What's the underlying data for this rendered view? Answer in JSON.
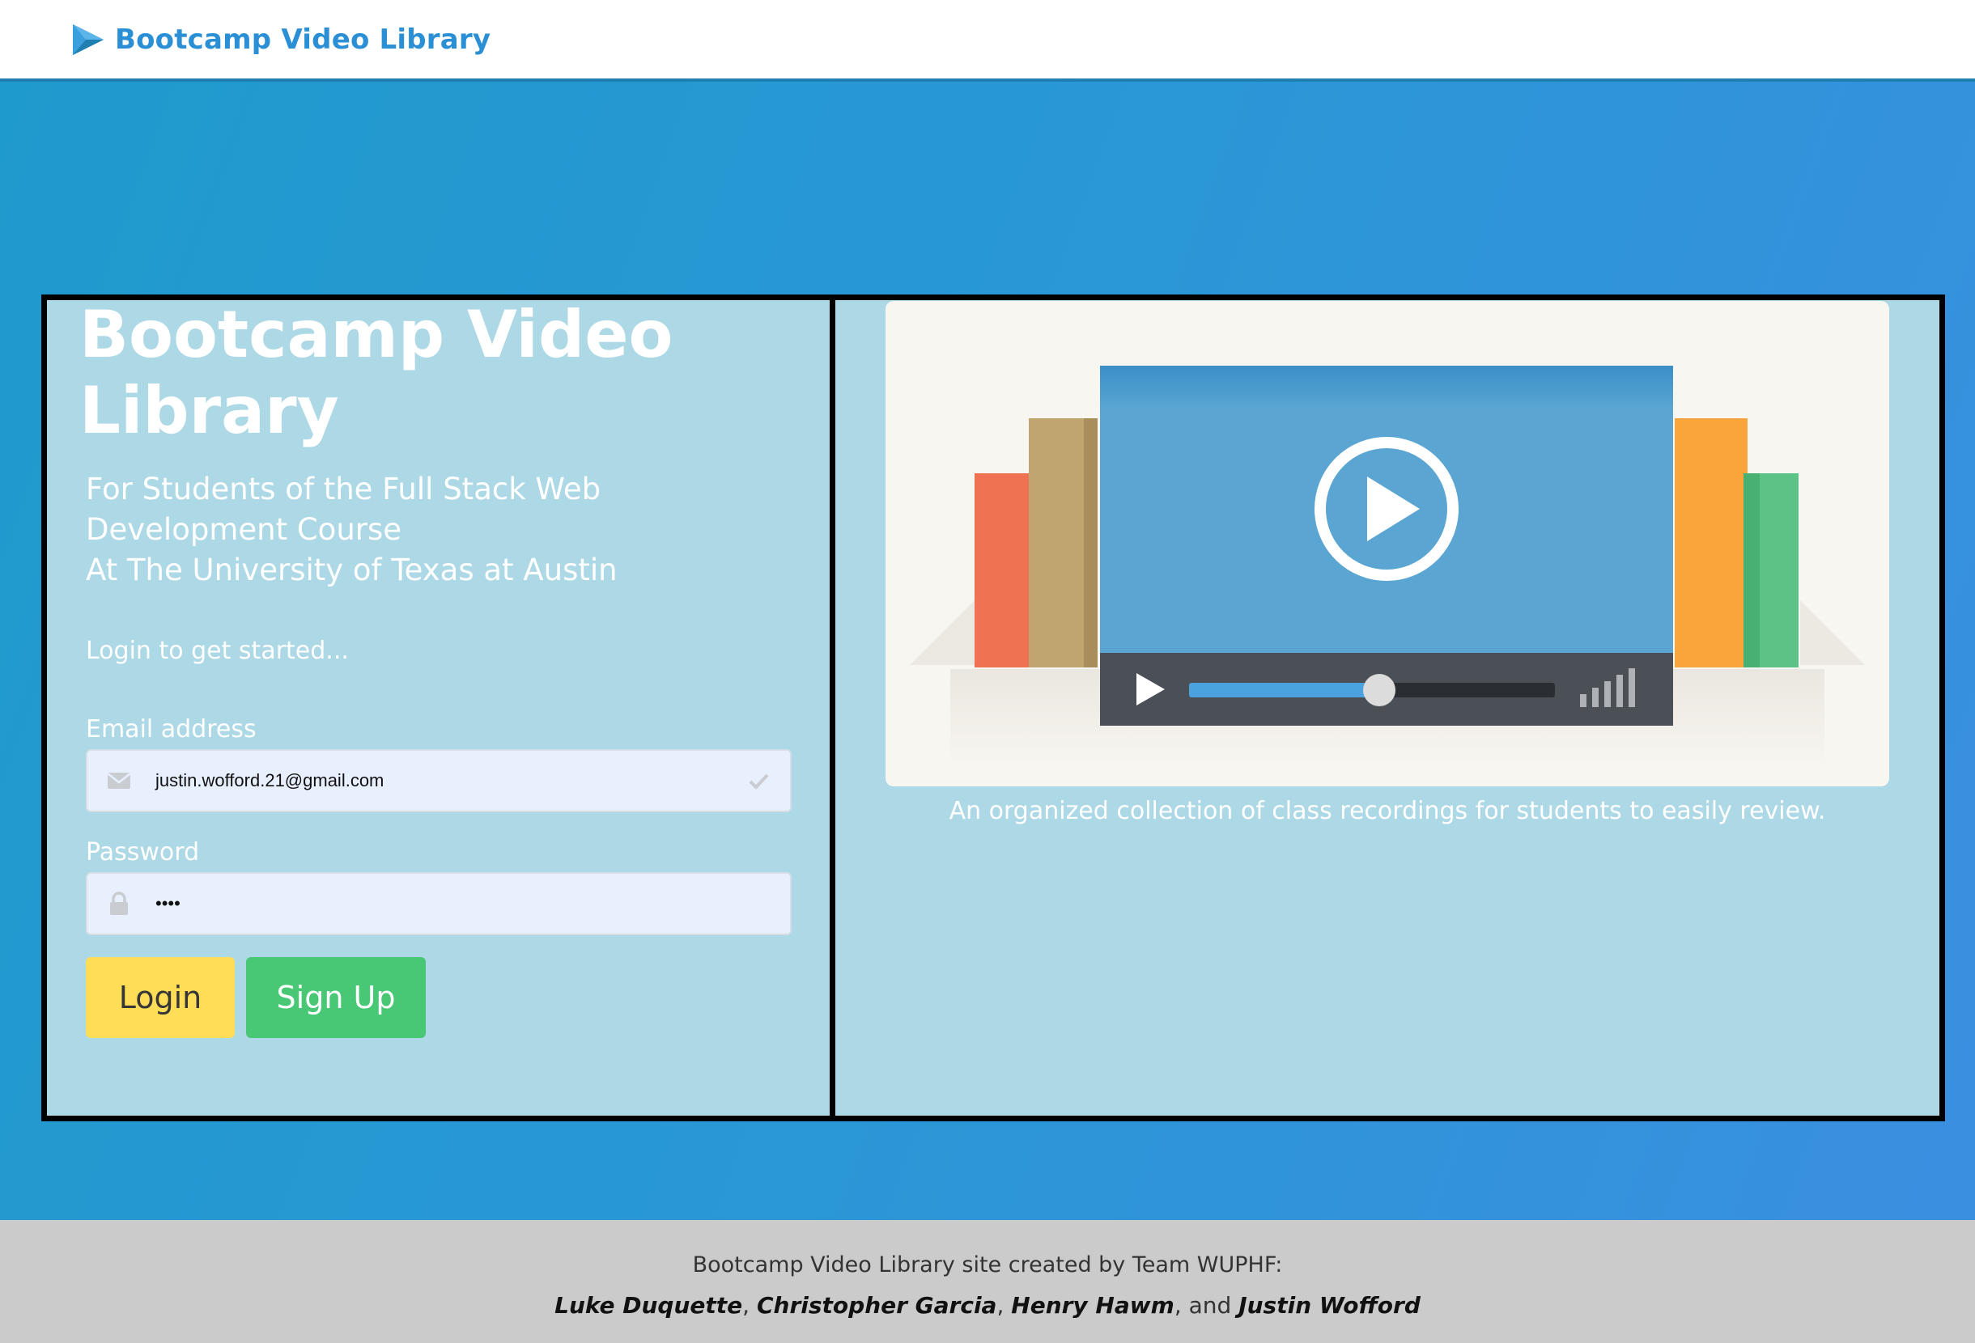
{
  "nav": {
    "brand": "Bootcamp Video Library"
  },
  "hero": {
    "title_line1": "Bootcamp Video",
    "title_line2": "Library",
    "subtitle_line1": "For Students of the Full Stack Web",
    "subtitle_line2": "Development Course",
    "subtitle_line3": "At The University of Texas at Austin",
    "prompt": "Login to get started..."
  },
  "form": {
    "email_label": "Email address",
    "email_value": "justin.wofford.21@gmail.com",
    "email_icon": "envelope-icon",
    "password_label": "Password",
    "password_value": "••••",
    "password_icon": "lock-icon",
    "login_label": "Login",
    "signup_label": "Sign Up"
  },
  "illustration": {
    "caption": "An organized collection of class recordings for students to easily review.",
    "progress": 0.52
  },
  "footer": {
    "line1": "Bootcamp Video Library site created by Team WUPHF:",
    "names": [
      "Luke Duquette",
      "Christopher Garcia",
      "Henry Hawm",
      "Justin Wofford"
    ],
    "sep1": ", ",
    "sep2": ", ",
    "sep3": ", and "
  },
  "colors": {
    "brand_blue": "#2a8fd4",
    "panel": "#add8e6",
    "login_button": "#ffdd57",
    "signup_button": "#48c774",
    "footer_bg": "#cbcbcb"
  }
}
